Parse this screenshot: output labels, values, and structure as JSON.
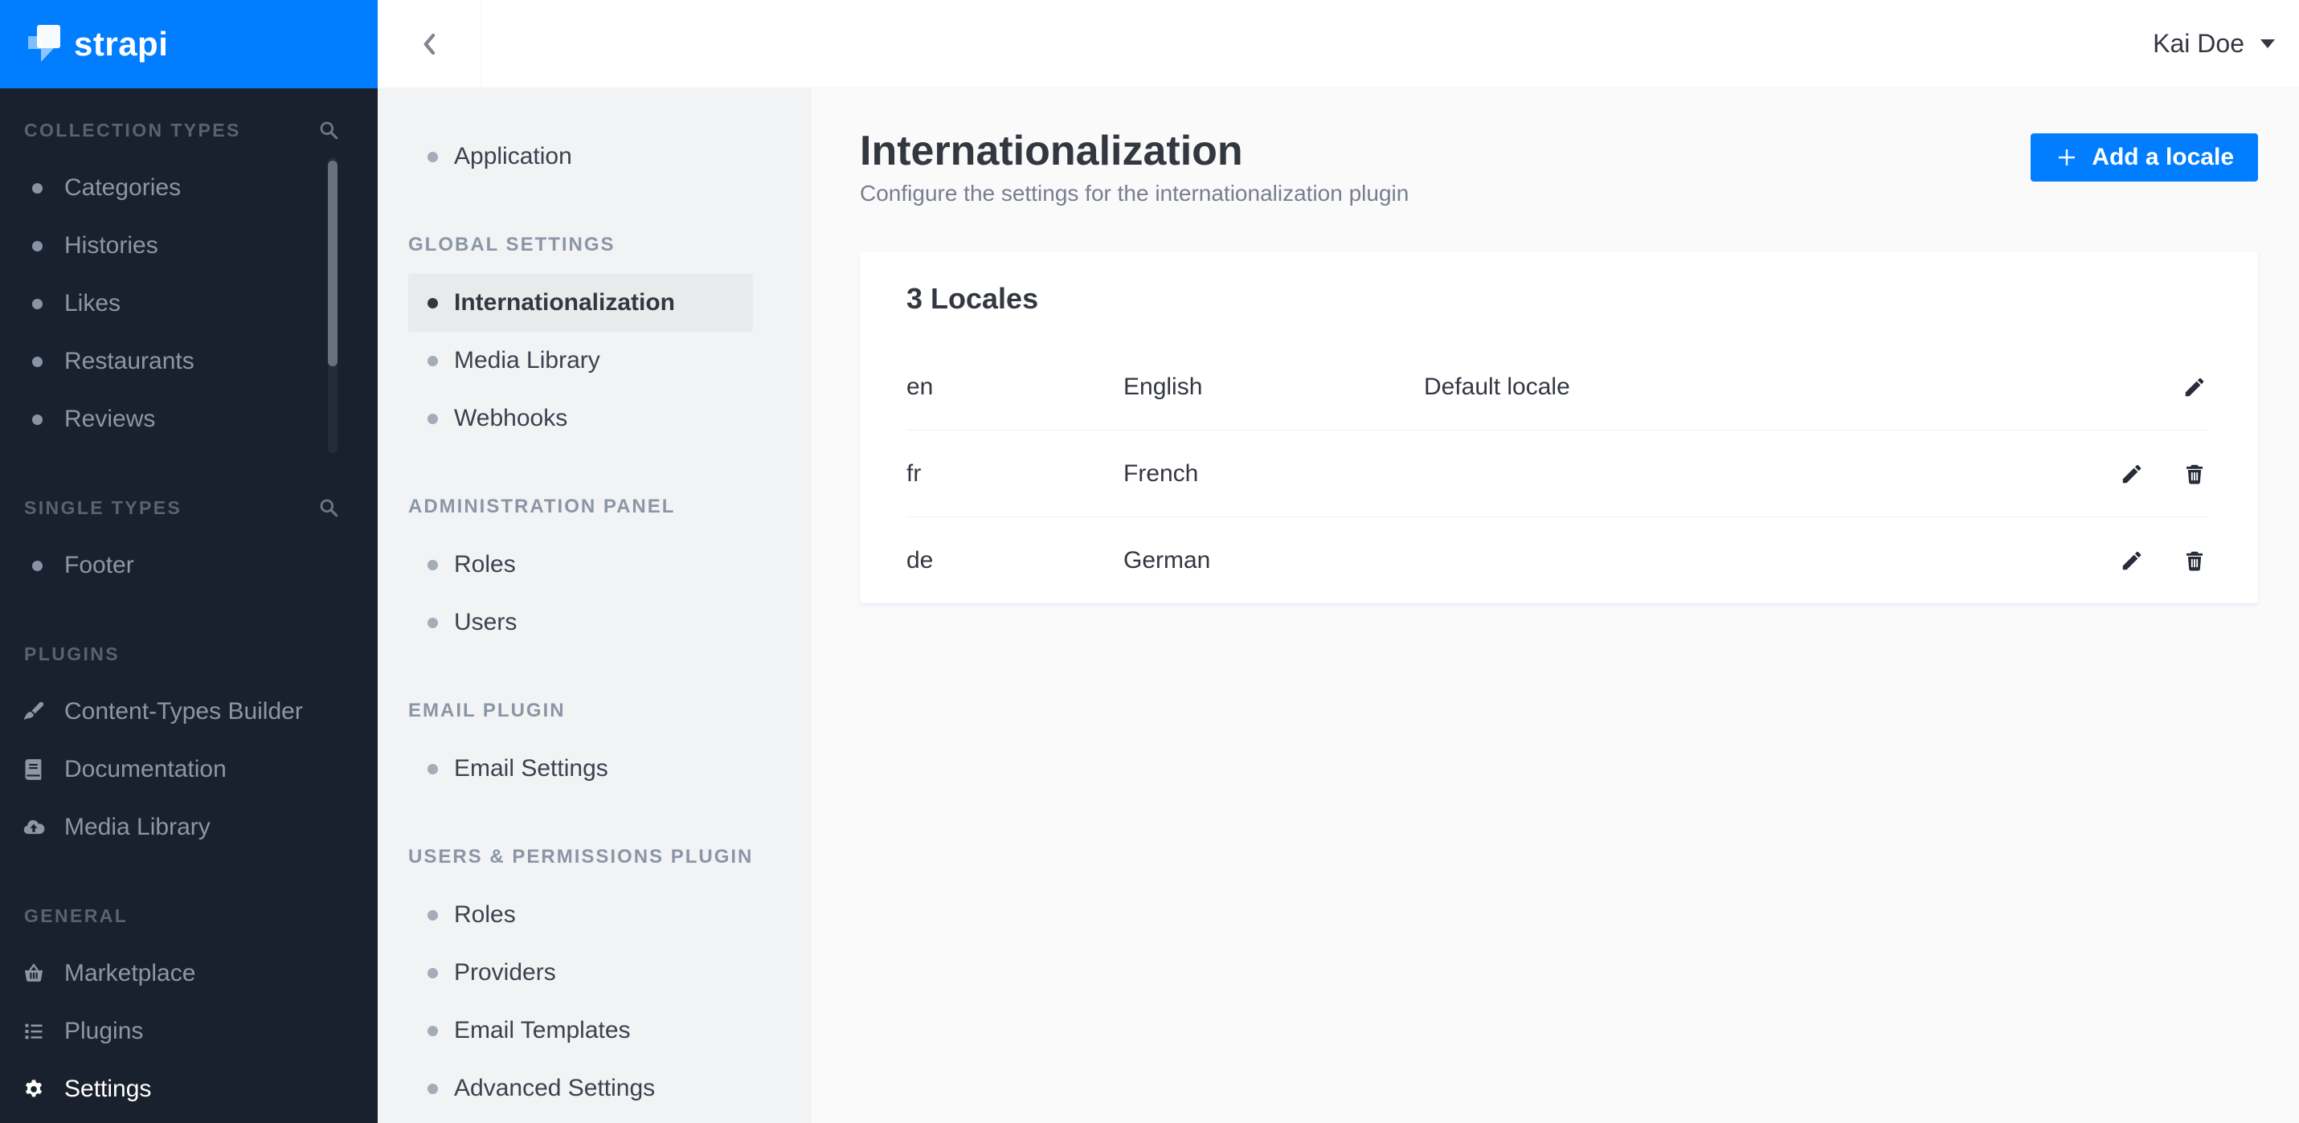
{
  "logo": {
    "text": "strapi"
  },
  "header": {
    "user_name": "Kai Doe"
  },
  "main_nav": {
    "sections": [
      {
        "label": "COLLECTION TYPES",
        "icon": "search-icon",
        "items": [
          {
            "label": "Categories"
          },
          {
            "label": "Histories"
          },
          {
            "label": "Likes"
          },
          {
            "label": "Restaurants"
          },
          {
            "label": "Reviews"
          }
        ]
      },
      {
        "label": "SINGLE TYPES",
        "icon": "search-icon",
        "items": [
          {
            "label": "Footer"
          }
        ]
      },
      {
        "label": "PLUGINS",
        "items": [
          {
            "label": "Content-Types Builder",
            "icon": "paintbrush-icon"
          },
          {
            "label": "Documentation",
            "icon": "book-icon"
          },
          {
            "label": "Media Library",
            "icon": "cloud-upload-icon"
          }
        ]
      },
      {
        "label": "GENERAL",
        "items": [
          {
            "label": "Marketplace",
            "icon": "basket-icon"
          },
          {
            "label": "Plugins",
            "icon": "list-icon"
          },
          {
            "label": "Settings",
            "icon": "gear-icon",
            "active": true
          }
        ]
      }
    ]
  },
  "settings_nav": {
    "standalone": [
      {
        "label": "Application"
      }
    ],
    "sections": [
      {
        "label": "GLOBAL SETTINGS",
        "items": [
          {
            "label": "Internationalization",
            "active": true
          },
          {
            "label": "Media Library"
          },
          {
            "label": "Webhooks"
          }
        ]
      },
      {
        "label": "ADMINISTRATION PANEL",
        "items": [
          {
            "label": "Roles"
          },
          {
            "label": "Users"
          }
        ]
      },
      {
        "label": "EMAIL PLUGIN",
        "items": [
          {
            "label": "Email Settings"
          }
        ]
      },
      {
        "label": "USERS & PERMISSIONS PLUGIN",
        "items": [
          {
            "label": "Roles"
          },
          {
            "label": "Providers"
          },
          {
            "label": "Email Templates"
          },
          {
            "label": "Advanced Settings"
          }
        ]
      }
    ]
  },
  "page": {
    "title": "Internationalization",
    "subtitle": "Configure the settings for the internationalization plugin",
    "add_locale_button": "Add a locale"
  },
  "locales": {
    "heading": "3 Locales",
    "rows": [
      {
        "code": "en",
        "name": "English",
        "default_label": "Default locale",
        "can_delete": false
      },
      {
        "code": "fr",
        "name": "French",
        "default_label": "",
        "can_delete": true
      },
      {
        "code": "de",
        "name": "German",
        "default_label": "",
        "can_delete": true
      }
    ]
  },
  "colors": {
    "primary_blue": "#007eff",
    "sidebar_dark": "#1a212e",
    "subnav_gray": "#f2f3f4",
    "content_bg": "#fafafb",
    "active_item_bg": "#e9eaeb",
    "text_dark": "#333740",
    "text_muted": "#787e8f"
  }
}
